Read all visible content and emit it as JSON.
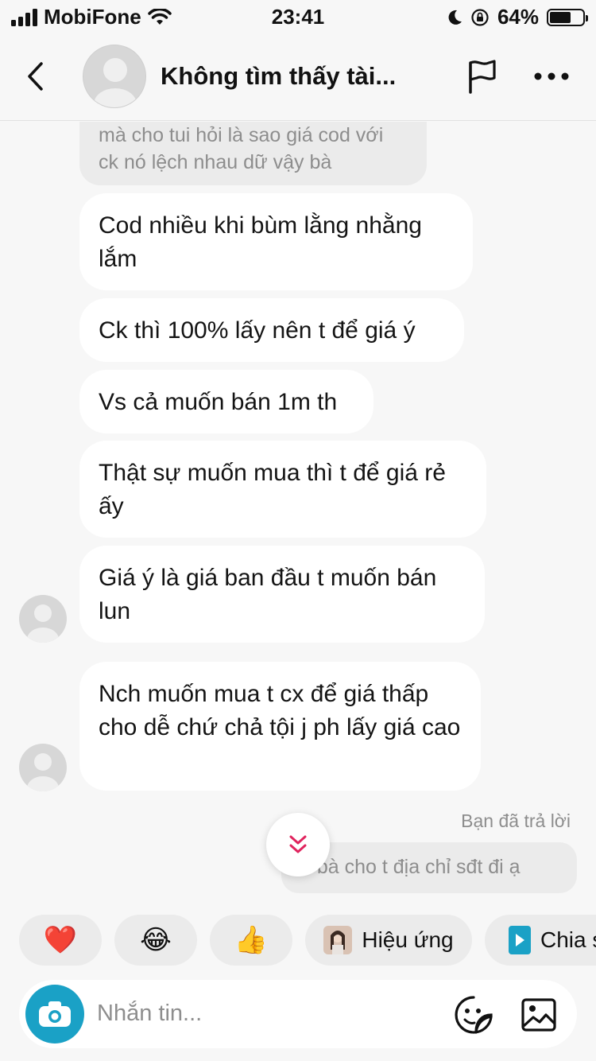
{
  "status_bar": {
    "carrier": "MobiFone",
    "time": "23:41",
    "battery": "64%",
    "battery_level": 0.64
  },
  "header": {
    "title": "Không tìm thấy tài..."
  },
  "messages": [
    {
      "text": "mà cho tui hỏi là sao giá cod với ck nó lệch nhau dữ vậy bà"
    },
    {
      "text": "Cod nhiều khi bùm lằng nhằng lắm"
    },
    {
      "text": "Ck thì 100% lấy nên t để giá ý"
    },
    {
      "text": "Vs cả muốn bán 1m th"
    },
    {
      "text": "Thật sự muốn mua thì t để giá rẻ ấy"
    },
    {
      "text": "Giá ý là giá ban đầu t muốn bán lun"
    },
    {
      "text": "Nch muốn mua t cx để giá thấp cho dễ chứ chả tội j ph lấy giá cao"
    }
  ],
  "reply_note": "Bạn đã trả lời",
  "reply_quote": "ế bà cho t địa chỉ sđt đi ạ",
  "quick_replies": [
    {
      "emoji": "❤️"
    },
    {
      "emoji": "😂"
    },
    {
      "emoji": "👍"
    },
    {
      "label": "Hiệu ứng"
    },
    {
      "label": "Chia s"
    }
  ],
  "composer": {
    "placeholder": "Nhắn tin..."
  },
  "icons": {
    "wifi": "wifi-icon",
    "moon": "moon-icon",
    "lock": "rotation-lock-icon",
    "back": "chevron-left-icon",
    "flag": "flag-icon",
    "more": "more-horizontal-icon",
    "scroll": "double-chevron-down-icon",
    "camera": "camera-icon",
    "sticker": "sticker-icon",
    "gallery": "image-icon"
  },
  "colors": {
    "camera_bg": "#1aa1c6",
    "scroll_chevron": "#e0245e",
    "share_icon": "#1aa1c6"
  }
}
